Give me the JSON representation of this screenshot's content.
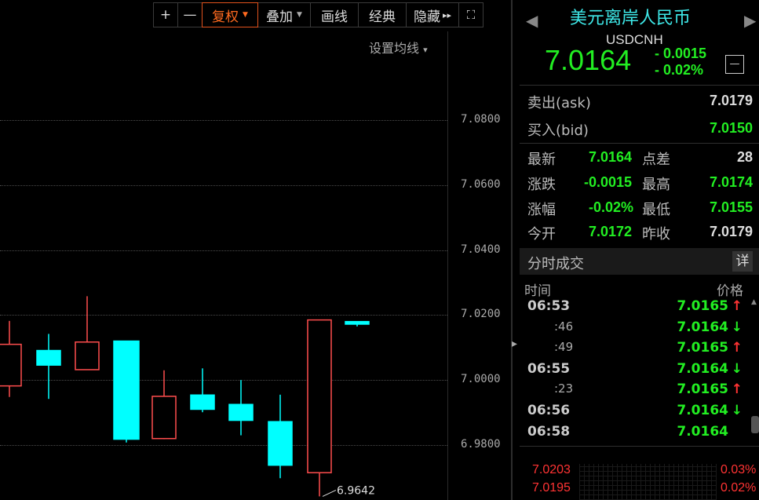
{
  "toolbar": {
    "plus": "+",
    "minus": "—",
    "fuquan": "复权",
    "diejia": "叠加",
    "huaxian": "画线",
    "jingdian": "经典",
    "yincang": "隐藏",
    "yincang_arrow": "▸▸",
    "fullscreen": "⛶"
  },
  "chart": {
    "set_ma": "设置均线",
    "set_ma_caret": "▾",
    "low_label": "6.9642"
  },
  "chart_data": {
    "type": "candlestick",
    "y_ticks": [
      "7.0800",
      "7.0600",
      "7.0400",
      "7.0200",
      "7.0000",
      "6.9800"
    ],
    "ylim": [
      6.964,
      7.095
    ],
    "candles": [
      {
        "open": 6.9982,
        "close": 7.011,
        "high": 7.0182,
        "low": 6.9948,
        "color": "#ff4d4d",
        "filled": false
      },
      {
        "open": 7.0091,
        "close": 7.0046,
        "high": 7.0142,
        "low": 6.9942,
        "color": "#00ffff",
        "filled": true
      },
      {
        "open": 7.0032,
        "close": 7.0117,
        "high": 7.0258,
        "low": 7.0032,
        "color": "#ff4d4d",
        "filled": false
      },
      {
        "open": 7.012,
        "close": 6.9818,
        "high": 7.012,
        "low": 6.9808,
        "color": "#00ffff",
        "filled": true
      },
      {
        "open": 6.982,
        "close": 6.995,
        "high": 7.003,
        "low": 6.9818,
        "color": "#ff4d4d",
        "filled": false
      },
      {
        "open": 6.9954,
        "close": 6.991,
        "high": 7.0036,
        "low": 6.9901,
        "color": "#00ffff",
        "filled": true
      },
      {
        "open": 6.9925,
        "close": 6.9876,
        "high": 7.0,
        "low": 6.983,
        "color": "#00ffff",
        "filled": true
      },
      {
        "open": 6.9872,
        "close": 6.9738,
        "high": 6.9955,
        "low": 6.9698,
        "color": "#00ffff",
        "filled": true
      },
      {
        "open": 6.9715,
        "close": 7.0185,
        "high": 7.0185,
        "low": 6.9642,
        "color": "#ff4d4d",
        "filled": false
      },
      {
        "open": 7.018,
        "close": 7.0172,
        "high": 7.018,
        "low": 7.0165,
        "color": "#00ffff",
        "filled": true
      }
    ]
  },
  "quote": {
    "name": "美元离岸人民币",
    "code": "USDCNH",
    "price": "7.0164",
    "change": "- 0.0015",
    "change_pct": "- 0.02%",
    "collapse": "—",
    "prev_arrow": "◀",
    "next_arrow": "▶",
    "ask_label": "卖出(ask)",
    "ask": "7.0179",
    "bid_label": "买入(bid)",
    "bid": "7.0150",
    "latest_label": "最新",
    "latest": "7.0164",
    "spread_label": "点差",
    "spread": "28",
    "chg_label": "涨跌",
    "chg": "-0.0015",
    "high_label": "最高",
    "high": "7.0174",
    "pct_label": "涨幅",
    "pct": "-0.02%",
    "low_label": "最低",
    "low": "7.0155",
    "open_label": "今开",
    "open": "7.0172",
    "prev_close_label": "昨收",
    "prev_close": "7.0179"
  },
  "ticks": {
    "title": "分时成交",
    "detail": "详",
    "col_time": "时间",
    "col_price": "价格",
    "rows": [
      {
        "time": "06:53",
        "sub": "",
        "price": "7.0165",
        "dir": "↑",
        "color": "#ff3333"
      },
      {
        "time": "",
        "sub": ":46",
        "price": "7.0164",
        "dir": "↓",
        "color": "#22ee22"
      },
      {
        "time": "",
        "sub": ":49",
        "price": "7.0165",
        "dir": "↑",
        "color": "#ff3333"
      },
      {
        "time": "06:55",
        "sub": "",
        "price": "7.0164",
        "dir": "↓",
        "color": "#22ee22"
      },
      {
        "time": "",
        "sub": ":23",
        "price": "7.0165",
        "dir": "↑",
        "color": "#ff3333"
      },
      {
        "time": "06:56",
        "sub": "",
        "price": "7.0164",
        "dir": "↓",
        "color": "#22ee22"
      },
      {
        "time": "06:58",
        "sub": "",
        "price": "7.0164",
        "dir": "",
        "color": "#22ee22"
      }
    ]
  },
  "mini": {
    "p1": "7.0203",
    "p2": "7.0195",
    "pct1": "0.03%",
    "pct2": "0.02%"
  }
}
